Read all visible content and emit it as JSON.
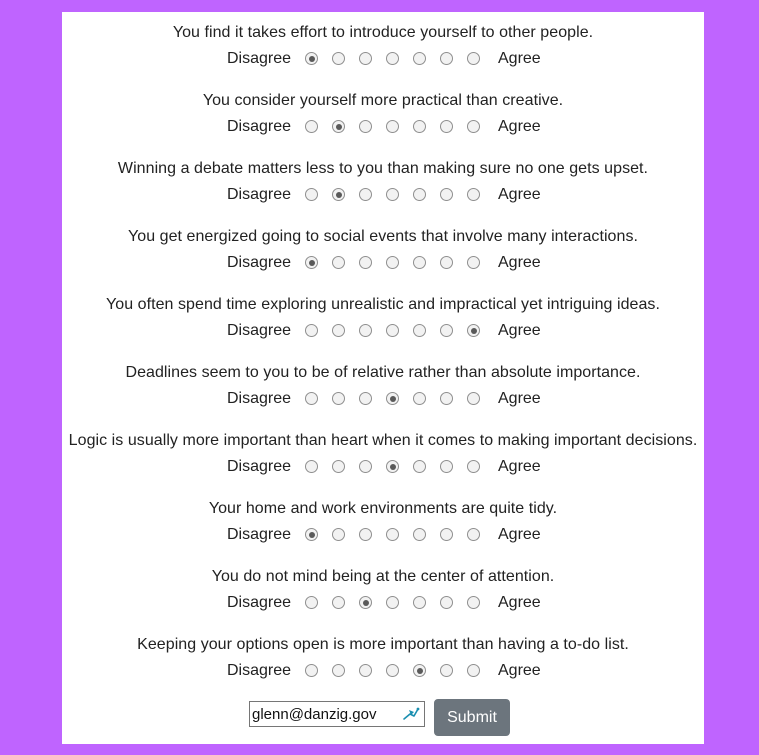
{
  "questions": [
    {
      "text": "You find it takes effort to introduce yourself to other people.",
      "selected": 1
    },
    {
      "text": "You consider yourself more practical than creative.",
      "selected": 2
    },
    {
      "text": "Winning a debate matters less to you than making sure no one gets upset.",
      "selected": 2
    },
    {
      "text": "You get energized going to social events that involve many interactions.",
      "selected": 1
    },
    {
      "text": "You often spend time exploring unrealistic and impractical yet intriguing ideas.",
      "selected": 7
    },
    {
      "text": "Deadlines seem to you to be of relative rather than absolute importance.",
      "selected": 4
    },
    {
      "text": "Logic is usually more important than heart when it comes to making important decisions.",
      "selected": 4
    },
    {
      "text": "Your home and work environments are quite tidy.",
      "selected": 1
    },
    {
      "text": "You do not mind being at the center of attention.",
      "selected": 3
    },
    {
      "text": "Keeping your options open is more important than having a to-do list.",
      "selected": 5
    }
  ],
  "scale": {
    "left_label": "Disagree",
    "right_label": "Agree",
    "points": 7
  },
  "form": {
    "email_value": "glenn@danzig.gov",
    "submit_label": "Submit",
    "autofill_icon": "password-manager-icon"
  },
  "colors": {
    "background": "#bf64ff",
    "panel": "#ffffff",
    "submit_button": "#6c757d"
  }
}
